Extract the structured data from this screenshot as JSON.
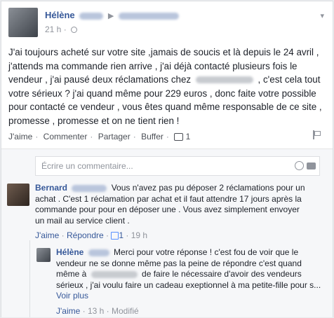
{
  "post": {
    "author": "Hélène",
    "time": "21 h",
    "text": "J'ai toujours acheté sur votre site ,jamais de soucis et là depuis le 24 avril , j'attends ma commande rien arrive , j'ai déjà contacté plusieurs fois le vendeur , j'ai pausé deux réclamations chez ",
    "text_tail": " , c'est cela tout votre sérieux ? j'ai quand même pour 229 euros , donc faite votre possible pour contacté ce vendeur , vous êtes quand même responsable de ce site , promesse , promesse et on ne tient rien !",
    "actions": {
      "like": "J'aime",
      "comment": "Commenter",
      "share": "Partager",
      "buffer": "Buffer",
      "comment_count": "1"
    }
  },
  "comment_box": {
    "placeholder": "Écrire un commentaire..."
  },
  "comments": [
    {
      "author": "Bernard",
      "text": "Vous n'avez pas pu déposer 2 réclamations pour un achat . C'est 1 réclamation par achat et il faut attendre 17 jours après la commande pour pour en déposer une . Vous avez simplement envoyer un mail au service client .",
      "like": "J'aime",
      "reply": "Répondre",
      "likes": "1",
      "time": "19 h"
    }
  ],
  "reply": {
    "author": "Hélène",
    "text_a": "Merci pour votre réponse ! c'est fou de voir que le vendeur ne se donne même pas la peine de répondre c'est quand même à ",
    "text_b": " de faire le nécessaire d'avoir des vendeurs sérieux , j'ai voulu faire un cadeau exeptionnel à ma petite-fille pour s...",
    "see_more": "Voir plus",
    "like": "J'aime",
    "time": "13 h",
    "edited": "Modifié"
  }
}
